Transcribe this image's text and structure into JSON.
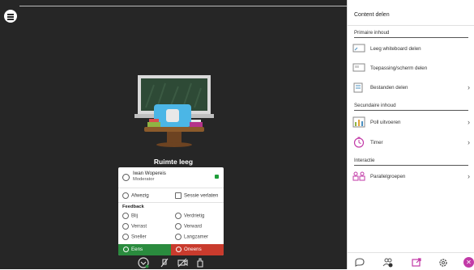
{
  "room": {
    "title": "Ruimte leeg"
  },
  "profile": {
    "name": "Iwan Wopereis",
    "role": "Moderator",
    "away": "Afwezig",
    "leave": "Sessie verlaten",
    "feedback_title": "Feedback",
    "feedback": [
      {
        "label": "Blij",
        "icon": "smile-icon"
      },
      {
        "label": "Verdrietig",
        "icon": "sad-icon"
      },
      {
        "label": "Verrast",
        "icon": "surprised-icon"
      },
      {
        "label": "Verward",
        "icon": "confused-icon"
      },
      {
        "label": "Sneller",
        "icon": "faster-icon"
      },
      {
        "label": "Langzamer",
        "icon": "slower-icon"
      }
    ],
    "agree": "Eens",
    "disagree": "Oneens"
  },
  "panel": {
    "title": "Content delen",
    "primary": "Primaire inhoud",
    "primary_items": [
      {
        "label": "Leeg whiteboard delen",
        "icon": "whiteboard-icon"
      },
      {
        "label": "Toepassing/scherm delen",
        "icon": "screen-share-icon"
      },
      {
        "label": "Bestanden delen",
        "icon": "files-icon"
      }
    ],
    "secondary": "Secundaire inhoud",
    "secondary_items": [
      {
        "label": "Poll uitvoeren",
        "icon": "poll-icon"
      },
      {
        "label": "Timer",
        "icon": "timer-icon"
      }
    ],
    "interaction": "Interactie",
    "interaction_items": [
      {
        "label": "Parallelgroepen",
        "icon": "breakout-groups-icon"
      }
    ]
  },
  "colors": {
    "agree": "#2a8b3e",
    "disagree": "#c93b2d",
    "accent": "#c23aa7",
    "stage": "#262626"
  }
}
